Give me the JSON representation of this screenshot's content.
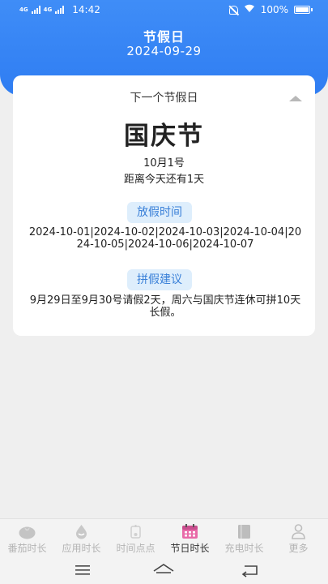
{
  "status_bar": {
    "network_left": "4G",
    "network_right": "4G",
    "time": "14:42",
    "battery": "100%"
  },
  "header": {
    "title": "节假日",
    "date": "2024-09-29"
  },
  "card": {
    "next_label": "下一个节假日",
    "holiday_name": "国庆节",
    "holiday_date": "10月1号",
    "countdown": "距离今天还有1天",
    "days_off_label": "放假时间",
    "days_off": "2024-10-01|2024-10-02|2024-10-03|2024-10-04|2024-10-05|2024-10-06|2024-10-07",
    "suggestion_label": "拼假建议",
    "suggestion": "9月29日至9月30号请假2天，周六与国庆节连休可拼10天长假。"
  },
  "tabs": [
    {
      "label": "番茄时长",
      "icon": "tomato-icon",
      "active": false
    },
    {
      "label": "应用时长",
      "icon": "drop-icon",
      "active": false
    },
    {
      "label": "时间点点",
      "icon": "hourglass-icon",
      "active": false
    },
    {
      "label": "节日时长",
      "icon": "calendar-icon",
      "active": true
    },
    {
      "label": "充电时长",
      "icon": "book-icon",
      "active": false
    },
    {
      "label": "更多",
      "icon": "person-icon",
      "active": false
    }
  ],
  "colors": {
    "header_blue": "#3a88f5",
    "pill_bg": "#deeefc",
    "pill_text": "#3a80d8",
    "calendar_pink": "#e86aa8"
  }
}
